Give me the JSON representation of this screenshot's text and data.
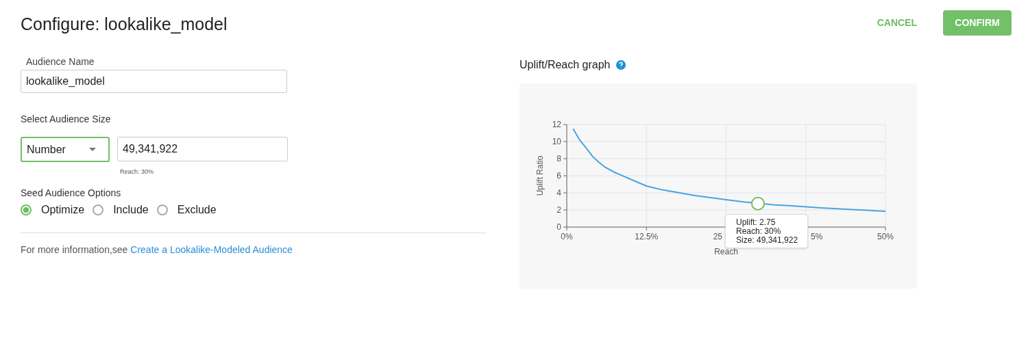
{
  "title": "Configure: lookalike_model",
  "actions": [
    {
      "label": "CANCEL",
      "kind": "text"
    },
    {
      "label": "CONFIRM",
      "kind": "primary"
    }
  ],
  "audience_name": {
    "label": "Audience Name",
    "value": "lookalike_model"
  },
  "audience_size": {
    "label": "Select Audience Size",
    "mode": "Number",
    "value": "49,341,922",
    "hint": "Reach: 30%"
  },
  "seed_options": {
    "label": "Seed Audience Options",
    "options": [
      {
        "label": "Optimize",
        "selected": true
      },
      {
        "label": "Include",
        "selected": false
      },
      {
        "label": "Exclude",
        "selected": false
      }
    ]
  },
  "info": {
    "text": "For more information,see",
    "link": "Create a Lookalike-Modeled Audience"
  },
  "graph": {
    "title": "Uplift/Reach graph",
    "chart_data": {
      "type": "line",
      "xlabel": "Reach",
      "ylabel": "Uplift Ratio",
      "x": [
        1,
        2,
        3,
        4,
        5,
        6,
        7.5,
        10,
        12.5,
        15,
        20,
        25,
        27.5,
        32.5,
        35,
        40,
        45,
        50
      ],
      "series": [
        {
          "color": "#4aa3e0",
          "values": [
            11.5,
            10.2,
            9.3,
            8.3,
            7.6,
            7.0,
            6.4,
            5.6,
            4.8,
            4.35,
            3.7,
            3.2,
            2.95,
            2.6,
            2.5,
            2.25,
            2.05,
            1.85
          ]
        }
      ],
      "xlim": [
        0,
        50
      ],
      "ylim": [
        0,
        12
      ],
      "grid": true,
      "xticks": [
        {
          "value": 0,
          "label": "0%"
        },
        {
          "value": 12.5,
          "label": "12.5%"
        },
        {
          "value": 50,
          "label": "50%"
        }
      ],
      "yticks": [
        0,
        2,
        4,
        6,
        8,
        10,
        12
      ],
      "annotations": [
        {
          "x": 30,
          "y": 2.75,
          "text": "Uplift: 2.75"
        }
      ]
    },
    "tooltip_more": [
      "Reach: 30%",
      "Size: 49,341,922"
    ],
    "covered_tick_labels": [
      "25",
      "5%"
    ]
  }
}
